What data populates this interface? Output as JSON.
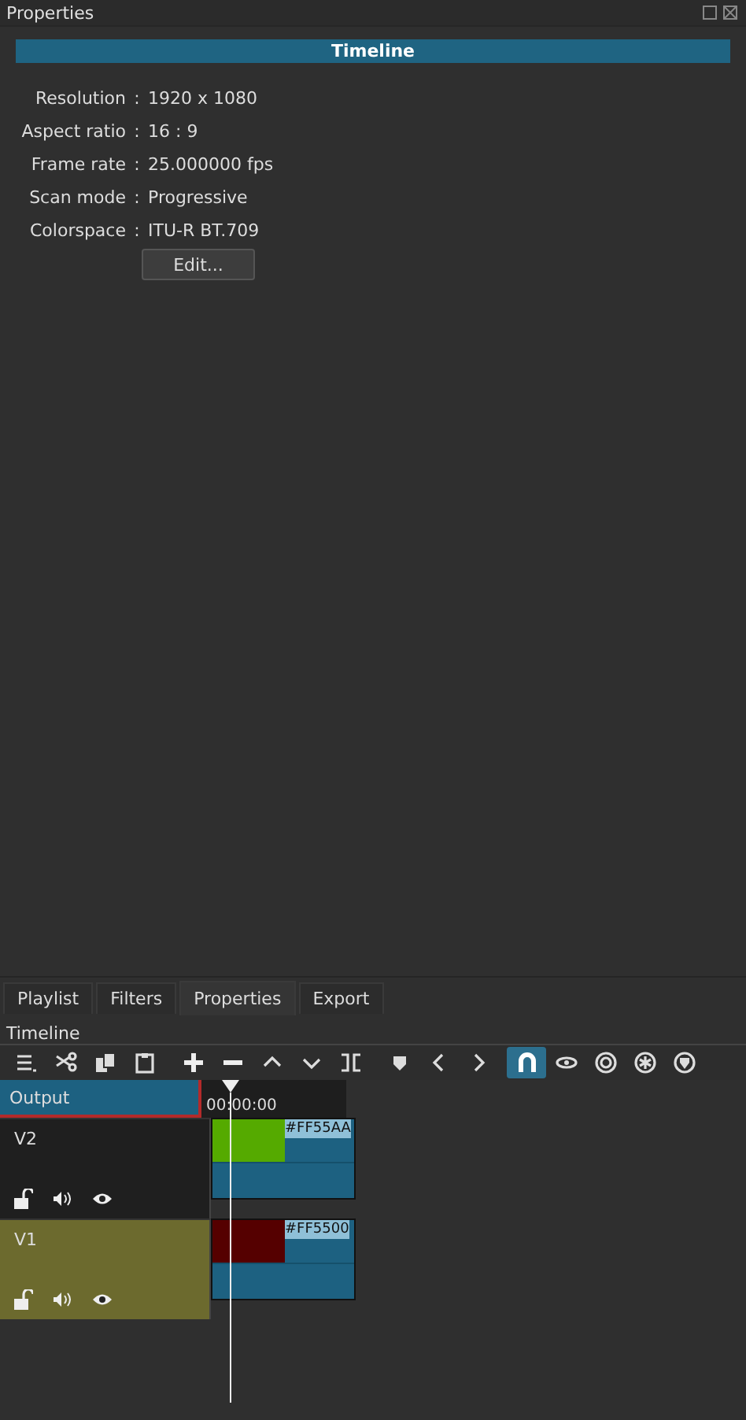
{
  "properties_panel": {
    "title": "Properties",
    "header": "Timeline",
    "fields": [
      {
        "label": "Resolution",
        "value": "1920 x 1080"
      },
      {
        "label": "Aspect ratio",
        "value": "16 : 9"
      },
      {
        "label": "Frame rate",
        "value": "25.000000 fps"
      },
      {
        "label": "Scan mode",
        "value": "Progressive"
      },
      {
        "label": "Colorspace",
        "value": "ITU-R BT.709"
      }
    ],
    "separator": ":",
    "edit_button": "Edit..."
  },
  "tabs": [
    {
      "label": "Playlist",
      "selected": false
    },
    {
      "label": "Filters",
      "selected": false
    },
    {
      "label": "Properties",
      "selected": true
    },
    {
      "label": "Export",
      "selected": false
    }
  ],
  "timeline": {
    "title": "Timeline",
    "tools": [
      {
        "kind": "menu",
        "on": false
      },
      {
        "kind": "cut",
        "on": false
      },
      {
        "kind": "copy",
        "on": false
      },
      {
        "kind": "paste",
        "on": false
      },
      {
        "kind": "add",
        "on": false
      },
      {
        "kind": "remove",
        "on": false
      },
      {
        "kind": "lift",
        "on": false
      },
      {
        "kind": "overwrite",
        "on": false
      },
      {
        "kind": "split",
        "on": false
      },
      {
        "kind": "marker",
        "on": false
      },
      {
        "kind": "prev",
        "on": false
      },
      {
        "kind": "next",
        "on": false
      },
      {
        "kind": "snap",
        "on": true
      },
      {
        "kind": "scrub",
        "on": false
      },
      {
        "kind": "ripple",
        "on": false
      },
      {
        "kind": "ripple-all",
        "on": false
      },
      {
        "kind": "ripple-markers",
        "on": false
      }
    ],
    "output": "Output",
    "timecode": "00:00:00",
    "tracks": [
      {
        "name": "V2",
        "selected": false,
        "clip": {
          "label": "#FF55AA",
          "color": "#55aa00"
        }
      },
      {
        "name": "V1",
        "selected": true,
        "clip": {
          "label": "#FF5500",
          "color": "#550000"
        }
      }
    ]
  }
}
